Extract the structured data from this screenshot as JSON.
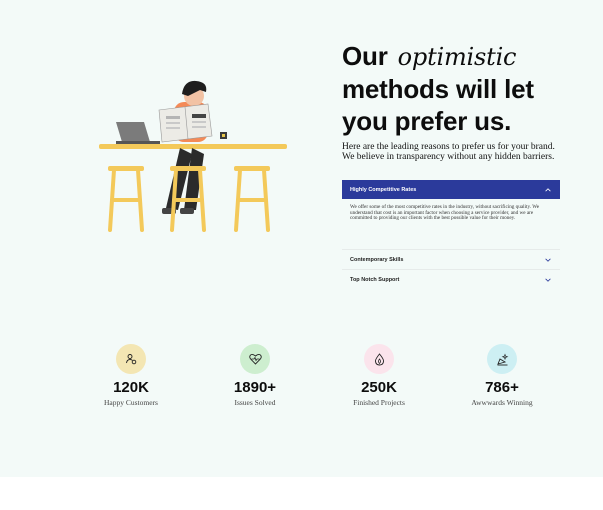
{
  "hero": {
    "heading_before": "Our",
    "heading_highlight": "optimistic",
    "heading_after": "methods will let you prefer us.",
    "intro": "Here are the leading reasons to prefer us for your brand. We believe in transparency without any hidden barriers."
  },
  "accordion": {
    "items": [
      {
        "title": "Highly Competitive Rates",
        "body": "We offer some of the most competitive rates in the industry, without sacrificing quality. We understand that cost is an important factor when choosing a service provider, and we are committed to providing our clients with the best possible value for their money.",
        "state": "open"
      },
      {
        "title": "Contemporary Skills",
        "state": "closed"
      },
      {
        "title": "Top Notch Support",
        "state": "closed"
      }
    ]
  },
  "stats": [
    {
      "value": "120K",
      "label": "Happy Customers",
      "icon": "user-settings-icon",
      "color": "#f3e6b3"
    },
    {
      "value": "1890+",
      "label": "Issues Solved",
      "icon": "heart-pulse-icon",
      "color": "#cdeecf"
    },
    {
      "value": "250K",
      "label": "Finished Projects",
      "icon": "flame-drop-icon",
      "color": "#fbe4ec"
    },
    {
      "value": "786+",
      "label": "Awwwards Winning",
      "icon": "award-sparkle-icon",
      "color": "#cdeff3"
    }
  ],
  "colors": {
    "section_bg": "#f3faf8",
    "accent": "#2b3a9b",
    "highlight": "#cfe4fb"
  }
}
